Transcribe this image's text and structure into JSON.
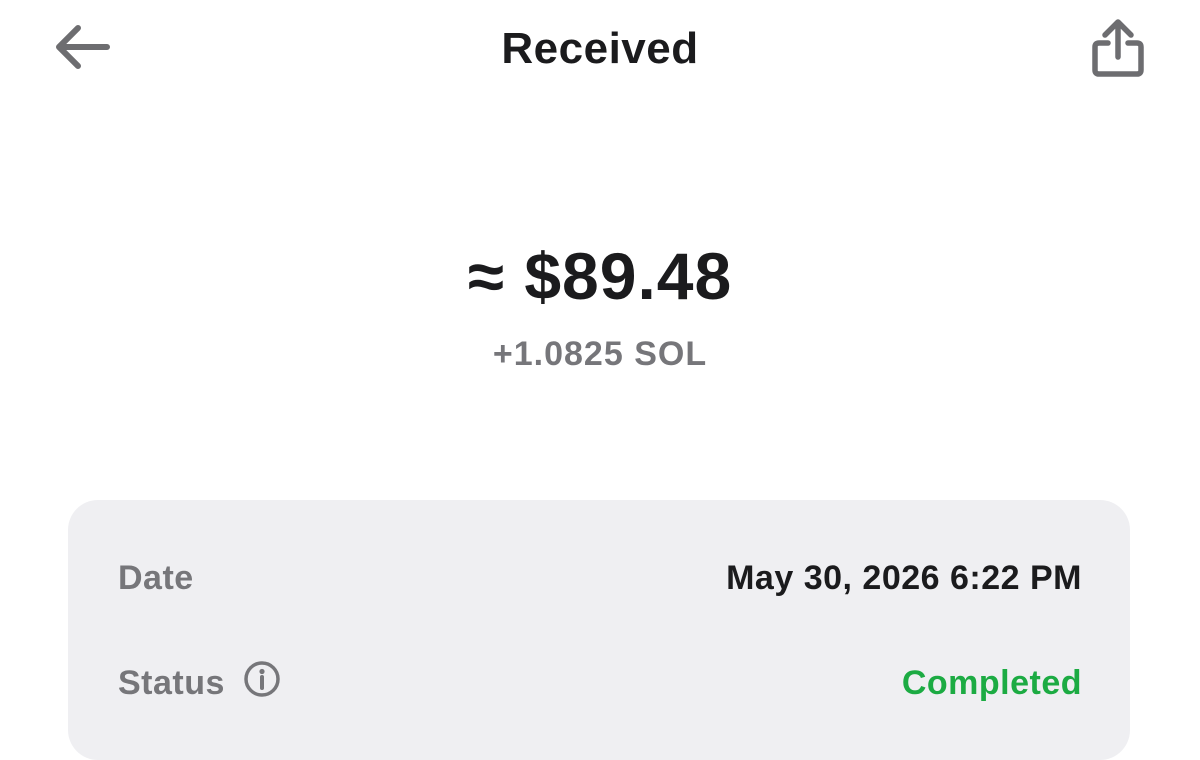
{
  "header": {
    "title": "Received",
    "back_icon": "arrow-left-icon",
    "share_icon": "share-icon"
  },
  "amount": {
    "fiat": "≈ $89.48",
    "crypto": "+1.0825 SOL"
  },
  "details": {
    "date_label": "Date",
    "date_value": "May 30, 2026 6:22 PM",
    "status_label": "Status",
    "status_value": "Completed",
    "status_info_icon": "info-icon"
  },
  "colors": {
    "text_primary": "#1b1b1d",
    "text_secondary": "#76767a",
    "card_background": "#efeff2",
    "status_completed": "#1cab43"
  }
}
